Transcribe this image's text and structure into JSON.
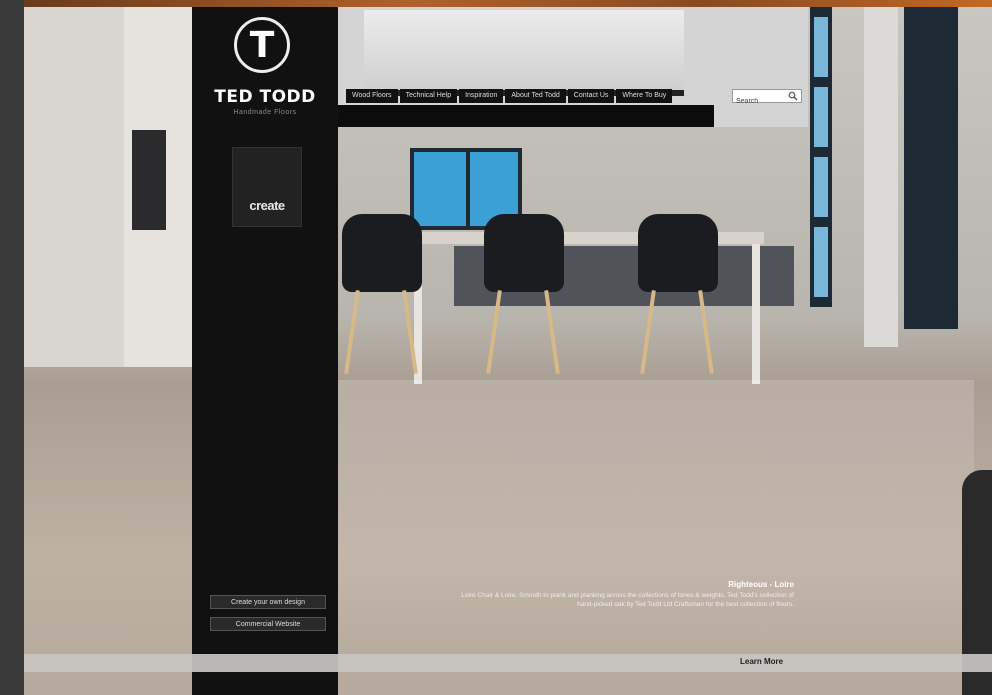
{
  "brand": {
    "logo_letter": "T",
    "name": "TED TODD",
    "tagline": "Handmade Floors"
  },
  "sidebar": {
    "create_logo_text": "create",
    "buttons": [
      {
        "label": "Create your own design"
      },
      {
        "label": "Commercial Website"
      }
    ]
  },
  "nav": {
    "items": [
      {
        "label": "Wood Floors"
      },
      {
        "label": "Technical Help"
      },
      {
        "label": "Inspiration"
      },
      {
        "label": "About Ted Todd"
      },
      {
        "label": "Contact Us"
      },
      {
        "label": "Where To Buy"
      }
    ],
    "search": {
      "value": "Search"
    }
  },
  "caption": {
    "title": "Righteous - Loire",
    "body": "Loire Chair & Loire: Smooth to plank and planking across the collections of tones & weights. Ted Todd's collection of hand-picked oak by Ted Todd Ltd Craftsmen for the best collection of floors."
  },
  "footer": {
    "learn_more": "Learn More"
  },
  "colors": {
    "sidebar": "#111111",
    "accent_strip": "#b0622a",
    "window_blue": "#3aa0d6"
  }
}
